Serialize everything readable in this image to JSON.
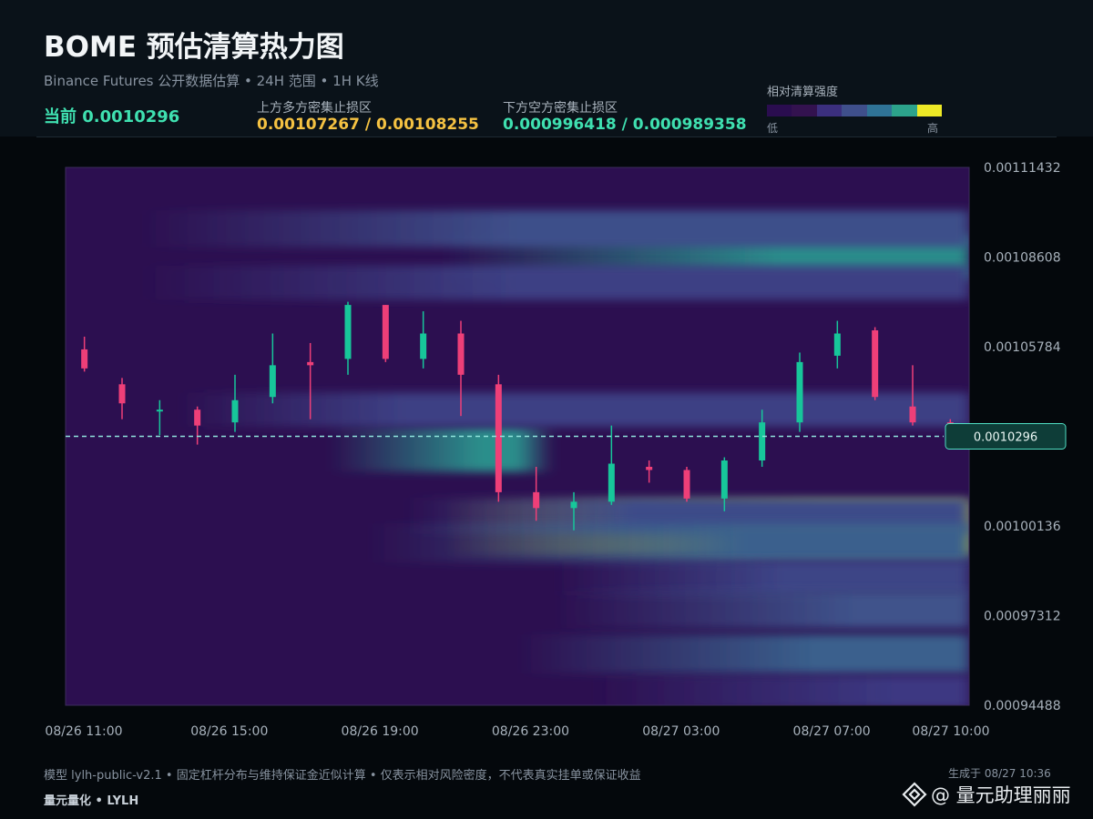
{
  "header": {
    "title": "BOME 预估清算热力图",
    "subtitle": "Binance Futures 公开数据估算 • 24H 范围 • 1H K线",
    "current": "当前 0.0010296",
    "upper_label": "上方多方密集止损区",
    "upper_value": "0.00107267 / 0.00108255",
    "lower_label": "下方空方密集止损区",
    "lower_value": "0.000996418 / 0.000989358"
  },
  "legend": {
    "title": "相对清算强度",
    "low": "低",
    "high": "高",
    "colors": [
      "#2a0d4f",
      "#33124f",
      "#3b2f7e",
      "#3f4f8b",
      "#2f7396",
      "#2ca38b",
      "#eee926"
    ]
  },
  "footer": {
    "note": "模型 lylh-public-v2.1 • 固定杠杆分布与维持保证金近似计算 • 仅表示相对风险密度，不代表真实挂单或保证收益",
    "brand": "量元量化 • LYLH",
    "generated": "生成于 08/27 10:36",
    "watermark": "@ 量元助理丽丽"
  },
  "chart_data": {
    "type": "heatmap",
    "overlay": "candlestick",
    "ylim": [
      0.00094488,
      0.00111432
    ],
    "y_ticks": [
      "0.00111432",
      "0.00108608",
      "0.00105784",
      "0.00100136",
      "0.00097312",
      "0.00094488"
    ],
    "x_ticks": [
      "08/26 11:00",
      "08/26 15:00",
      "08/26 19:00",
      "08/26 23:00",
      "08/27 03:00",
      "08/27 07:00",
      "08/27 10:00"
    ],
    "x_tick_hours": [
      0,
      4,
      8,
      12,
      16,
      20,
      23
    ],
    "current_price": 0.0010296,
    "current_price_label": "0.0010296",
    "candle_up_color": "#17c69a",
    "candle_down_color": "#ee3f78",
    "current_line_color": "#8fe3dc",
    "candles": [
      {
        "o": 0.001057,
        "h": 0.001061,
        "l": 0.00105,
        "c": 0.001051
      },
      {
        "o": 0.001046,
        "h": 0.001048,
        "l": 0.001035,
        "c": 0.00104
      },
      {
        "o": 0.001038,
        "h": 0.001041,
        "l": 0.00103,
        "c": 0.001038
      },
      {
        "o": 0.001038,
        "h": 0.001039,
        "l": 0.001027,
        "c": 0.001033
      },
      {
        "o": 0.001034,
        "h": 0.001049,
        "l": 0.001031,
        "c": 0.001041
      },
      {
        "o": 0.001042,
        "h": 0.001062,
        "l": 0.00104,
        "c": 0.001052
      },
      {
        "o": 0.001053,
        "h": 0.001059,
        "l": 0.001035,
        "c": 0.001052
      },
      {
        "o": 0.001054,
        "h": 0.001072,
        "l": 0.001049,
        "c": 0.001071
      },
      {
        "o": 0.001071,
        "h": 0.001071,
        "l": 0.001053,
        "c": 0.001054
      },
      {
        "o": 0.001054,
        "h": 0.001069,
        "l": 0.001051,
        "c": 0.001062
      },
      {
        "o": 0.001062,
        "h": 0.001066,
        "l": 0.001036,
        "c": 0.001049
      },
      {
        "o": 0.001046,
        "h": 0.001049,
        "l": 0.001009,
        "c": 0.001012
      },
      {
        "o": 0.001012,
        "h": 0.00102,
        "l": 0.001003,
        "c": 0.001007
      },
      {
        "o": 0.001007,
        "h": 0.001012,
        "l": 0.001,
        "c": 0.001009
      },
      {
        "o": 0.001009,
        "h": 0.001033,
        "l": 0.001008,
        "c": 0.001021
      },
      {
        "o": 0.00102,
        "h": 0.001022,
        "l": 0.001015,
        "c": 0.001019
      },
      {
        "o": 0.001019,
        "h": 0.00102,
        "l": 0.001009,
        "c": 0.00101
      },
      {
        "o": 0.00101,
        "h": 0.001023,
        "l": 0.001006,
        "c": 0.001022
      },
      {
        "o": 0.001022,
        "h": 0.001038,
        "l": 0.00102,
        "c": 0.001034
      },
      {
        "o": 0.001034,
        "h": 0.001056,
        "l": 0.001031,
        "c": 0.001053
      },
      {
        "o": 0.001055,
        "h": 0.001066,
        "l": 0.001051,
        "c": 0.001062
      },
      {
        "o": 0.001063,
        "h": 0.001064,
        "l": 0.001041,
        "c": 0.001042
      },
      {
        "o": 0.001039,
        "h": 0.001052,
        "l": 0.001033,
        "c": 0.001034
      },
      {
        "o": 0.001034,
        "h": 0.001035,
        "l": 0.001028,
        "c": 0.00103
      }
    ],
    "bands": [
      {
        "price": 0.0010008,
        "intensity": 0.98,
        "start_hour": 10,
        "ramp_hours": 10
      },
      {
        "price": 0.0010046,
        "intensity": 0.4,
        "start_hour": 9,
        "ramp_hours": 6
      },
      {
        "price": 0.0010255,
        "intensity": 0.68,
        "start_hour": 7,
        "ramp_hours": 4,
        "end_hour": 12
      },
      {
        "price": 0.001086,
        "intensity": 0.68,
        "start_hour": 10,
        "ramp_hours": 9
      },
      {
        "price": 0.001095,
        "intensity": 0.42,
        "start_hour": 2,
        "ramp_hours": 10
      },
      {
        "price": 0.001078,
        "intensity": 0.34,
        "start_hour": 2,
        "ramp_hours": 10
      },
      {
        "price": 0.000996,
        "intensity": 0.5,
        "start_hour": 8,
        "ramp_hours": 10
      },
      {
        "price": 0.000985,
        "intensity": 0.36,
        "start_hour": 13,
        "ramp_hours": 6
      },
      {
        "price": 0.000975,
        "intensity": 0.44,
        "start_hour": 13,
        "ramp_hours": 8
      },
      {
        "price": 0.000961,
        "intensity": 0.5,
        "start_hour": 12,
        "ramp_hours": 8
      },
      {
        "price": 0.000949,
        "intensity": 0.3,
        "start_hour": 14,
        "ramp_hours": 8
      },
      {
        "price": 0.001038,
        "intensity": 0.34,
        "start_hour": 3,
        "ramp_hours": 6
      }
    ],
    "grid": false
  }
}
